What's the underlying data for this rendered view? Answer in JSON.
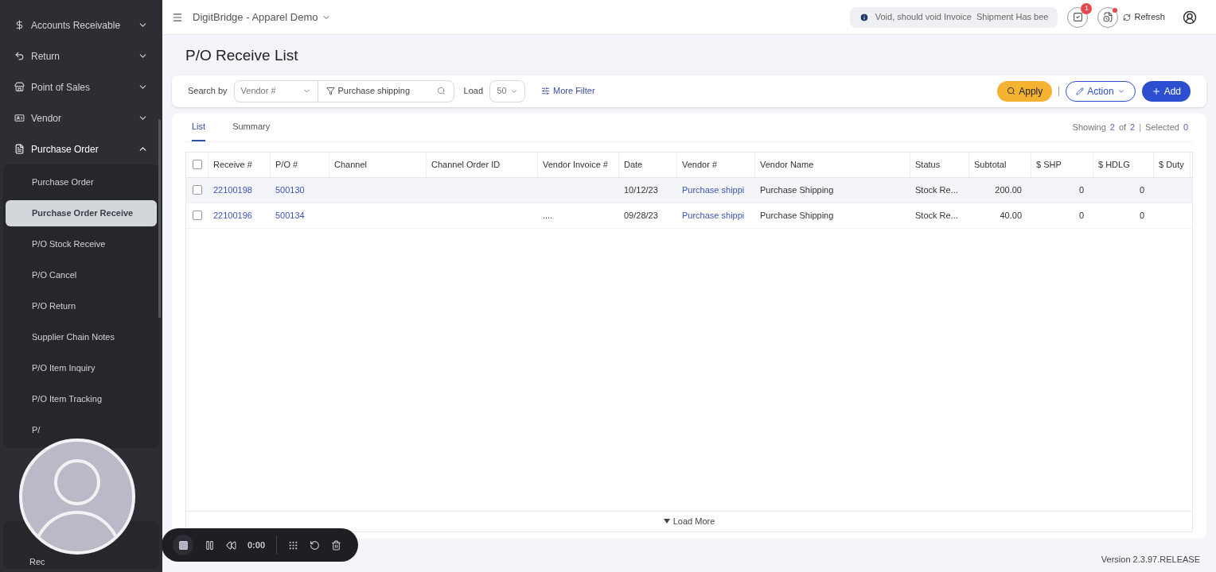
{
  "sidebar": {
    "items": [
      {
        "label": "Accounts Receivable",
        "expanded": false
      },
      {
        "label": "Return",
        "expanded": false
      },
      {
        "label": "Point of Sales",
        "expanded": false
      },
      {
        "label": "Vendor",
        "expanded": false
      },
      {
        "label": "Purchase Order",
        "expanded": true,
        "children": [
          {
            "label": "Purchase Order",
            "selected": false
          },
          {
            "label": "Purchase Order Receive",
            "selected": true
          },
          {
            "label": "P/O Stock Receive",
            "selected": false
          },
          {
            "label": "P/O Cancel",
            "selected": false
          },
          {
            "label": "P/O Return",
            "selected": false
          },
          {
            "label": "Supplier Chain Notes",
            "selected": false
          },
          {
            "label": "P/O Item Inquiry",
            "selected": false
          },
          {
            "label": "P/O Item Tracking",
            "selected": false
          },
          {
            "label": "P/",
            "selected": false
          }
        ]
      }
    ],
    "bottom_item": "Rec"
  },
  "header": {
    "title": "DigitBridge - Apparel Demo",
    "notice": "Void, should void Invoice  Shipment Has bee",
    "task_badge": "1",
    "refresh": "Refresh"
  },
  "page_title": "P/O Receive List",
  "filter": {
    "search_by_label": "Search by",
    "search_by": "Vendor #",
    "search_value": "Purchase shipping",
    "load_label": "Load",
    "load": "50",
    "more_filter": "More Filter",
    "apply": "Apply",
    "action": "Action",
    "add": "Add"
  },
  "tabs": [
    {
      "label": "List",
      "selected": true
    },
    {
      "label": "Summary",
      "selected": false
    }
  ],
  "summary": {
    "showing": "Showing",
    "shown": "2",
    "of": "of",
    "total": "2",
    "separator": "|",
    "selected_label": "Selected",
    "selected": "0"
  },
  "table": {
    "all_checked": false,
    "columns": [
      "Receive #",
      "P/O #",
      "Channel",
      "Channel Order ID",
      "Vendor Invoice #",
      "Date",
      "Vendor #",
      "Vendor Name",
      "Status",
      "Subtotal",
      "$ SHP",
      "$ HDLG",
      "$ Duty"
    ],
    "rows": [
      {
        "checked": false,
        "hovered": true,
        "cells": [
          "22100198",
          "500130",
          "",
          "",
          "",
          "10/12/23",
          "Purchase shippi",
          "Purchase Shipping",
          "Stock Re...",
          "200.00",
          "0",
          "0",
          ""
        ]
      },
      {
        "checked": false,
        "hovered": false,
        "cells": [
          "22100196",
          "500134",
          "",
          "",
          "....",
          "09/28/23",
          "Purchase shippi",
          "Purchase Shipping",
          "Stock Re...",
          "40.00",
          "0",
          "0",
          ""
        ]
      }
    ],
    "load_more": "Load More"
  },
  "recorder": {
    "time": "0:00"
  },
  "version": "Version 2.3.97.RELEASE"
}
